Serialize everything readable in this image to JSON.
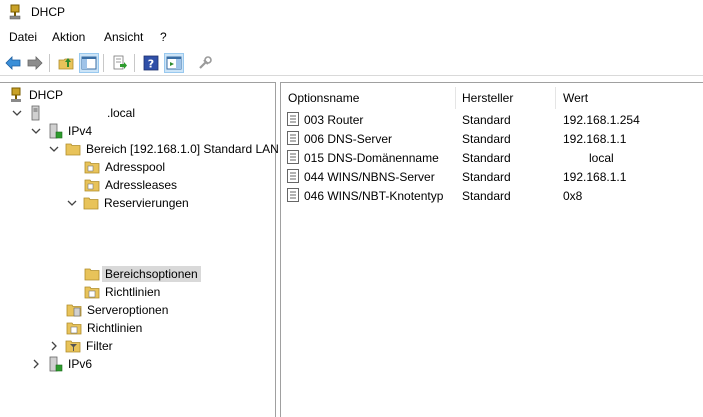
{
  "window": {
    "title": "DHCP"
  },
  "menu": [
    "Datei",
    "Aktion",
    "Ansicht",
    "?"
  ],
  "toolbar": {
    "buttons": [
      "back-icon",
      "forward-icon",
      "folder-up-icon",
      "console-tree-icon",
      "export-icon",
      "help-icon",
      "show-hide-icon",
      "properties-icon"
    ]
  },
  "tree": {
    "root": "DHCP",
    "server": ".local",
    "ipv4": "IPv4",
    "scope": "Bereich [192.168.1.0] Standard LAN",
    "address_pool": "Adresspool",
    "address_leases": "Adressleases",
    "reservations": "Reservierungen",
    "scope_options": "Bereichsoptionen",
    "scope_policies": "Richtlinien",
    "server_options": "Serveroptionen",
    "policies": "Richtlinien",
    "filter": "Filter",
    "ipv6": "IPv6"
  },
  "list": {
    "columns": [
      "Optionsname",
      "Hersteller",
      "Wert"
    ],
    "rows": [
      [
        "003 Router",
        "Standard",
        "192.168.1.254"
      ],
      [
        "006 DNS-Server",
        "Standard",
        "192.168.1.1"
      ],
      [
        "015 DNS-Domänenname",
        "Standard",
        "local"
      ],
      [
        "044 WINS/NBNS-Server",
        "Standard",
        "192.168.1.1"
      ],
      [
        "046 WINS/NBT-Knotentyp",
        "Standard",
        "0x8"
      ]
    ]
  },
  "colors": {
    "folder": "#e8c35a",
    "selection": "#d9d9d9",
    "toolbar_pressed": "#cce4f7"
  }
}
